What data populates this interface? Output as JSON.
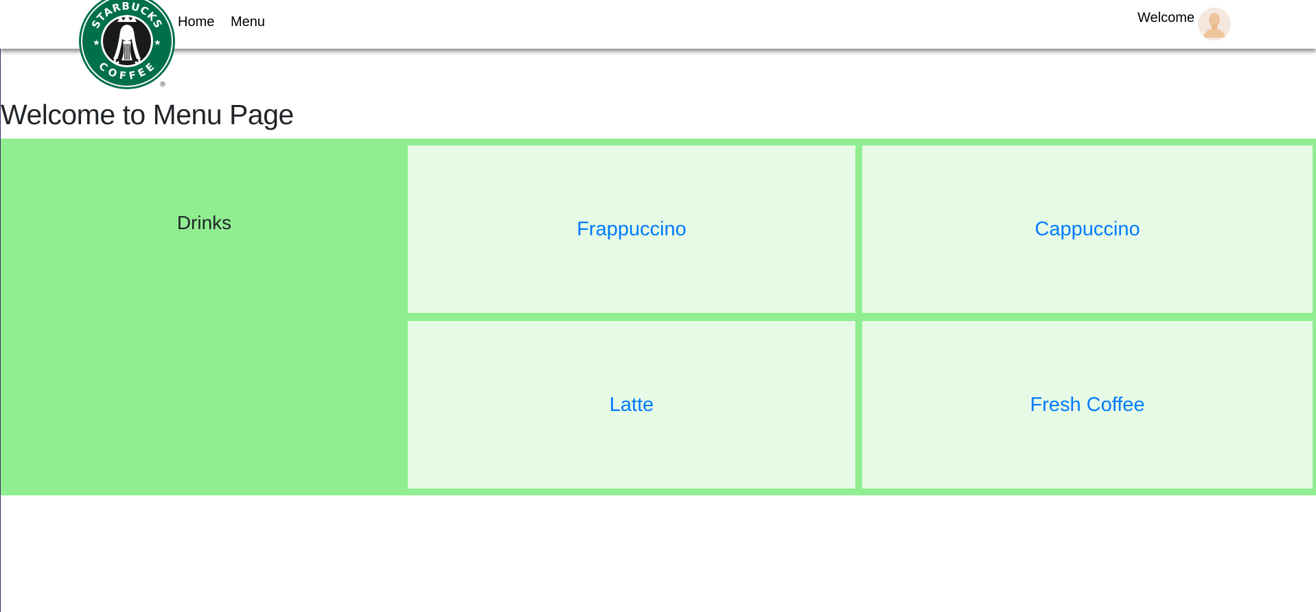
{
  "nav": {
    "logo": {
      "top_text": "STARBUCKS",
      "bottom_text": "COFFEE",
      "registered_mark": "®",
      "brand_color": "#00704a"
    },
    "links": [
      {
        "label": "Home"
      },
      {
        "label": "Menu"
      }
    ],
    "welcome_label": "Welcome",
    "avatar_icon": "user-avatar-icon"
  },
  "page": {
    "title": "Welcome to Menu Page"
  },
  "menu": {
    "category": "Drinks",
    "items": [
      {
        "label": "Frappuccino"
      },
      {
        "label": "Cappuccino"
      },
      {
        "label": "Latte"
      },
      {
        "label": "Fresh Coffee"
      }
    ],
    "colors": {
      "section_bg": "#90ee90",
      "tile_bg": "#e6fae6",
      "link": "#007bff"
    }
  }
}
